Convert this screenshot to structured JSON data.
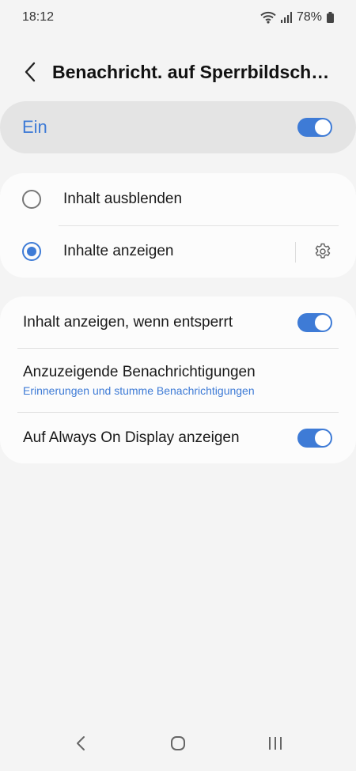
{
  "status_bar": {
    "time": "18:12",
    "battery_percent": "78%",
    "icons": [
      "wifi-icon",
      "signal-icon",
      "battery-icon"
    ]
  },
  "header": {
    "back_icon": "back-arrow-icon",
    "title": "Benachricht. auf Sperrbildschi…"
  },
  "master_toggle": {
    "label": "Ein",
    "on": true
  },
  "content_options": [
    {
      "label": "Inhalt ausblenden",
      "selected": false
    },
    {
      "label": "Inhalte anzeigen",
      "selected": true,
      "settings_icon": "gear-icon"
    }
  ],
  "settings": [
    {
      "title": "Inhalt anzeigen, wenn entsperrt",
      "toggle_on": true
    },
    {
      "title": "Anzuzeigende Benachrichtigungen",
      "subtitle": "Erinnerungen und stumme Benachrichtigungen"
    },
    {
      "title": "Auf Always On Display anzeigen",
      "toggle_on": true
    }
  ],
  "nav_bar": {
    "icons": [
      "back-nav-icon",
      "home-nav-icon",
      "recents-nav-icon"
    ]
  },
  "colors": {
    "accent": "#3e7bd6",
    "background": "#f4f4f4",
    "card": "#fcfcfc",
    "master_card": "#e4e4e4"
  }
}
